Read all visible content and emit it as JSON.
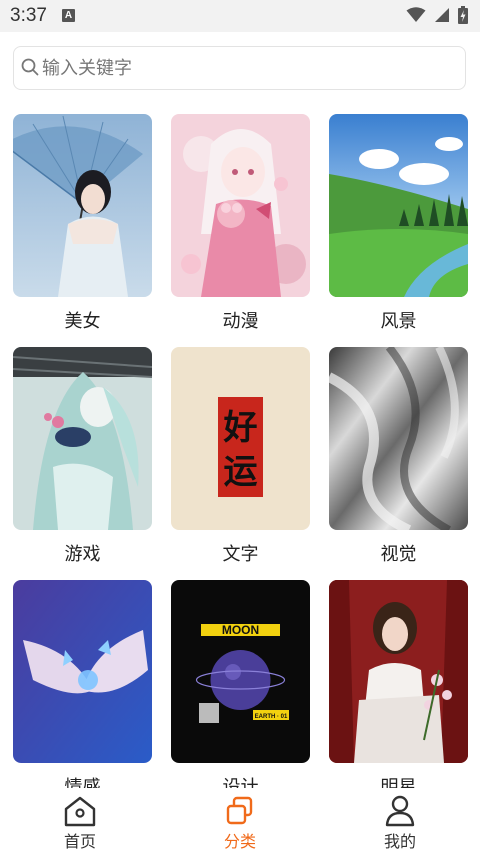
{
  "status_bar": {
    "time": "3:37",
    "notification_letter": "A"
  },
  "search": {
    "placeholder": "输入关键字"
  },
  "categories": [
    {
      "label": "美女"
    },
    {
      "label": "动漫"
    },
    {
      "label": "风景"
    },
    {
      "label": "游戏"
    },
    {
      "label": "文字"
    },
    {
      "label": "视觉"
    },
    {
      "label": "情感"
    },
    {
      "label": "设计"
    },
    {
      "label": "明星"
    }
  ],
  "poster_text": {
    "calligraphy_1": "好",
    "calligraphy_2": "运",
    "moon_title": "MOON",
    "moon_sub": "EARTH · 01"
  },
  "tabbar": {
    "items": [
      {
        "label": "首页",
        "icon": "home-icon"
      },
      {
        "label": "分类",
        "icon": "category-icon"
      },
      {
        "label": "我的",
        "icon": "profile-icon"
      }
    ],
    "active": "分类",
    "active_color": "#f06a1a"
  }
}
